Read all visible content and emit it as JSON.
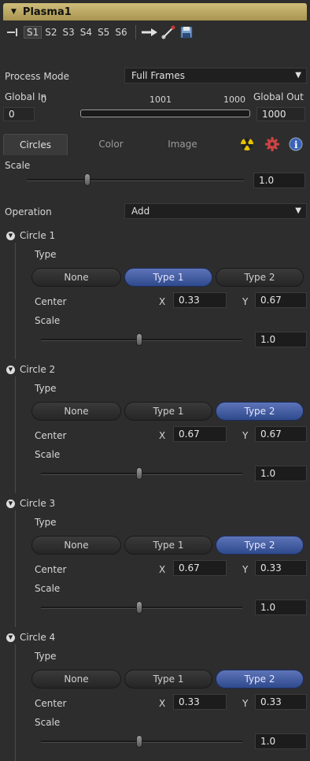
{
  "title": "Plasma1",
  "versions": [
    "S1",
    "S2",
    "S3",
    "S4",
    "S5",
    "S6"
  ],
  "active_version": "S1",
  "process_mode": {
    "label": "Process Mode",
    "value": "Full Frames"
  },
  "range": {
    "global_in_label": "Global In",
    "global_out_label": "Global Out",
    "start": "0",
    "middle": "1001",
    "end": "1000",
    "global_in_value": "0",
    "global_out_value": "1000"
  },
  "tabs": [
    {
      "label": "Circles",
      "active": true
    },
    {
      "label": "Color",
      "active": false
    },
    {
      "label": "Image",
      "active": false
    }
  ],
  "scale": {
    "label": "Scale",
    "value": "1.0",
    "level": 0.28
  },
  "operation": {
    "label": "Operation",
    "value": "Add"
  },
  "circles": [
    {
      "name": "Circle 1",
      "type_label": "Type",
      "options": [
        "None",
        "Type 1",
        "Type 2"
      ],
      "selected": "Type 1",
      "center_label": "Center",
      "x_label": "X",
      "x": "0.33",
      "y_label": "Y",
      "y": "0.67",
      "scale_label": "Scale",
      "scale": "1.0",
      "level": 0.49
    },
    {
      "name": "Circle 2",
      "type_label": "Type",
      "options": [
        "None",
        "Type 1",
        "Type 2"
      ],
      "selected": "Type 2",
      "center_label": "Center",
      "x_label": "X",
      "x": "0.67",
      "y_label": "Y",
      "y": "0.67",
      "scale_label": "Scale",
      "scale": "1.0",
      "level": 0.49
    },
    {
      "name": "Circle 3",
      "type_label": "Type",
      "options": [
        "None",
        "Type 1",
        "Type 2"
      ],
      "selected": "Type 2",
      "center_label": "Center",
      "x_label": "X",
      "x": "0.67",
      "y_label": "Y",
      "y": "0.33",
      "scale_label": "Scale",
      "scale": "1.0",
      "level": 0.49
    },
    {
      "name": "Circle 4",
      "type_label": "Type",
      "options": [
        "None",
        "Type 1",
        "Type 2"
      ],
      "selected": "Type 2",
      "center_label": "Center",
      "x_label": "X",
      "x": "0.33",
      "y_label": "Y",
      "y": "0.33",
      "scale_label": "Scale",
      "scale": "1.0",
      "level": 0.49
    }
  ],
  "colors": {
    "title_bar": "#bfae68",
    "selected_button": "#4a64a8"
  }
}
